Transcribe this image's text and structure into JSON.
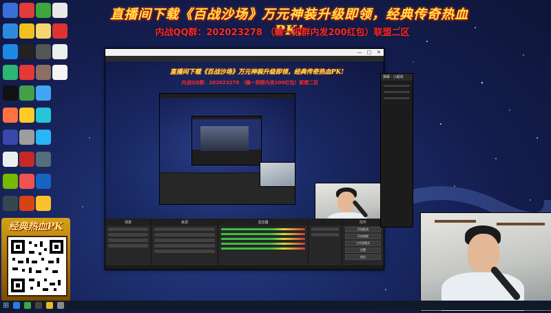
{
  "banner": {
    "title": "直播间下载《百战沙场》万元神装升级即领，经典传奇热血PK!",
    "qq_line": "内战QQ群：202023278 （输一把群内发200红包）联盟二区"
  },
  "promo": {
    "logo_text": "经典热血PK"
  },
  "obs": {
    "window_controls": {
      "minimize": "—",
      "maximize": "□",
      "close": "✕"
    },
    "preview": {
      "title": "直播间下载《百战沙场》万元神装升级即领，经典传奇热血PK!",
      "qq_line": "内战QQ群：202023278 （输一把群内发200红包）联盟二区"
    },
    "docks": {
      "scenes_header": "场景",
      "sources_header": "来源",
      "mixer_header": "混音器",
      "controls_header": "控件",
      "controls_buttons": [
        "开始推流",
        "开始录制",
        "工作室模式",
        "设置",
        "退出"
      ]
    }
  },
  "chat": {
    "header": "弹幕 · 小超哥"
  },
  "colors": {
    "banner_title": "#ffe14a",
    "banner_qq": "#ff2a2a",
    "obs_bg": "#1e1e1e",
    "desktop_bg": "#1a2a66"
  }
}
